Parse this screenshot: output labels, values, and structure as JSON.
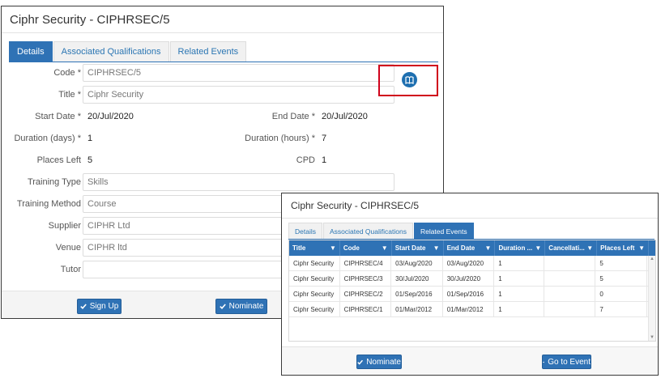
{
  "main_window": {
    "title": "Ciphr Security - CIPHRSEC/5",
    "tabs": [
      "Details",
      "Associated Qualifications",
      "Related Events"
    ],
    "fields": {
      "code_label": "Code *",
      "code_value": "CIPHRSEC/5",
      "title_label": "Title *",
      "title_value": "Ciphr Security",
      "start_date_label": "Start Date *",
      "start_date_value": "20/Jul/2020",
      "end_date_label": "End Date *",
      "end_date_value": "20/Jul/2020",
      "duration_days_label": "Duration (days) *",
      "duration_days_value": "1",
      "duration_hours_label": "Duration (hours) *",
      "duration_hours_value": "7",
      "places_left_label": "Places Left",
      "places_left_value": "5",
      "cpd_label": "CPD",
      "cpd_value": "1",
      "training_type_label": "Training Type",
      "training_type_value": "Skills",
      "training_method_label": "Training Method",
      "training_method_value": "Course",
      "supplier_label": "Supplier",
      "supplier_value": "CIPHR Ltd",
      "venue_label": "Venue",
      "venue_value": "CIPHR ltd",
      "tutor_label": "Tutor",
      "tutor_value": ""
    },
    "buttons": {
      "sign_up": "Sign Up",
      "nominate": "Nominate"
    }
  },
  "popup_window": {
    "title": "Ciphr Security - CIPHRSEC/5",
    "tabs": [
      "Details",
      "Associated Qualifications",
      "Related Events"
    ],
    "grid": {
      "columns": [
        "Title",
        "Code",
        "Start Date",
        "End Date",
        "Duration ...",
        "Cancellati...",
        "Places Left"
      ],
      "rows": [
        [
          "Ciphr Security",
          "CIPHRSEC/4",
          "03/Aug/2020",
          "03/Aug/2020",
          "1",
          "",
          "5"
        ],
        [
          "Ciphr Security",
          "CIPHRSEC/3",
          "30/Jul/2020",
          "30/Jul/2020",
          "1",
          "",
          "5"
        ],
        [
          "Ciphr Security",
          "CIPHRSEC/2",
          "01/Sep/2016",
          "01/Sep/2016",
          "1",
          "",
          "0"
        ],
        [
          "Ciphr Security",
          "CIPHRSEC/1",
          "01/Mar/2012",
          "01/Mar/2012",
          "1",
          "",
          "7"
        ]
      ]
    },
    "buttons": {
      "nominate": "Nominate",
      "go_to_event": "Go to Event"
    }
  },
  "colors": {
    "accent": "#2f72b5",
    "highlight": "#d0021b"
  },
  "icons": {
    "lookup": "book-icon",
    "filter": "filter-icon",
    "check": "check-icon",
    "arrow": "arrow-right-icon"
  }
}
